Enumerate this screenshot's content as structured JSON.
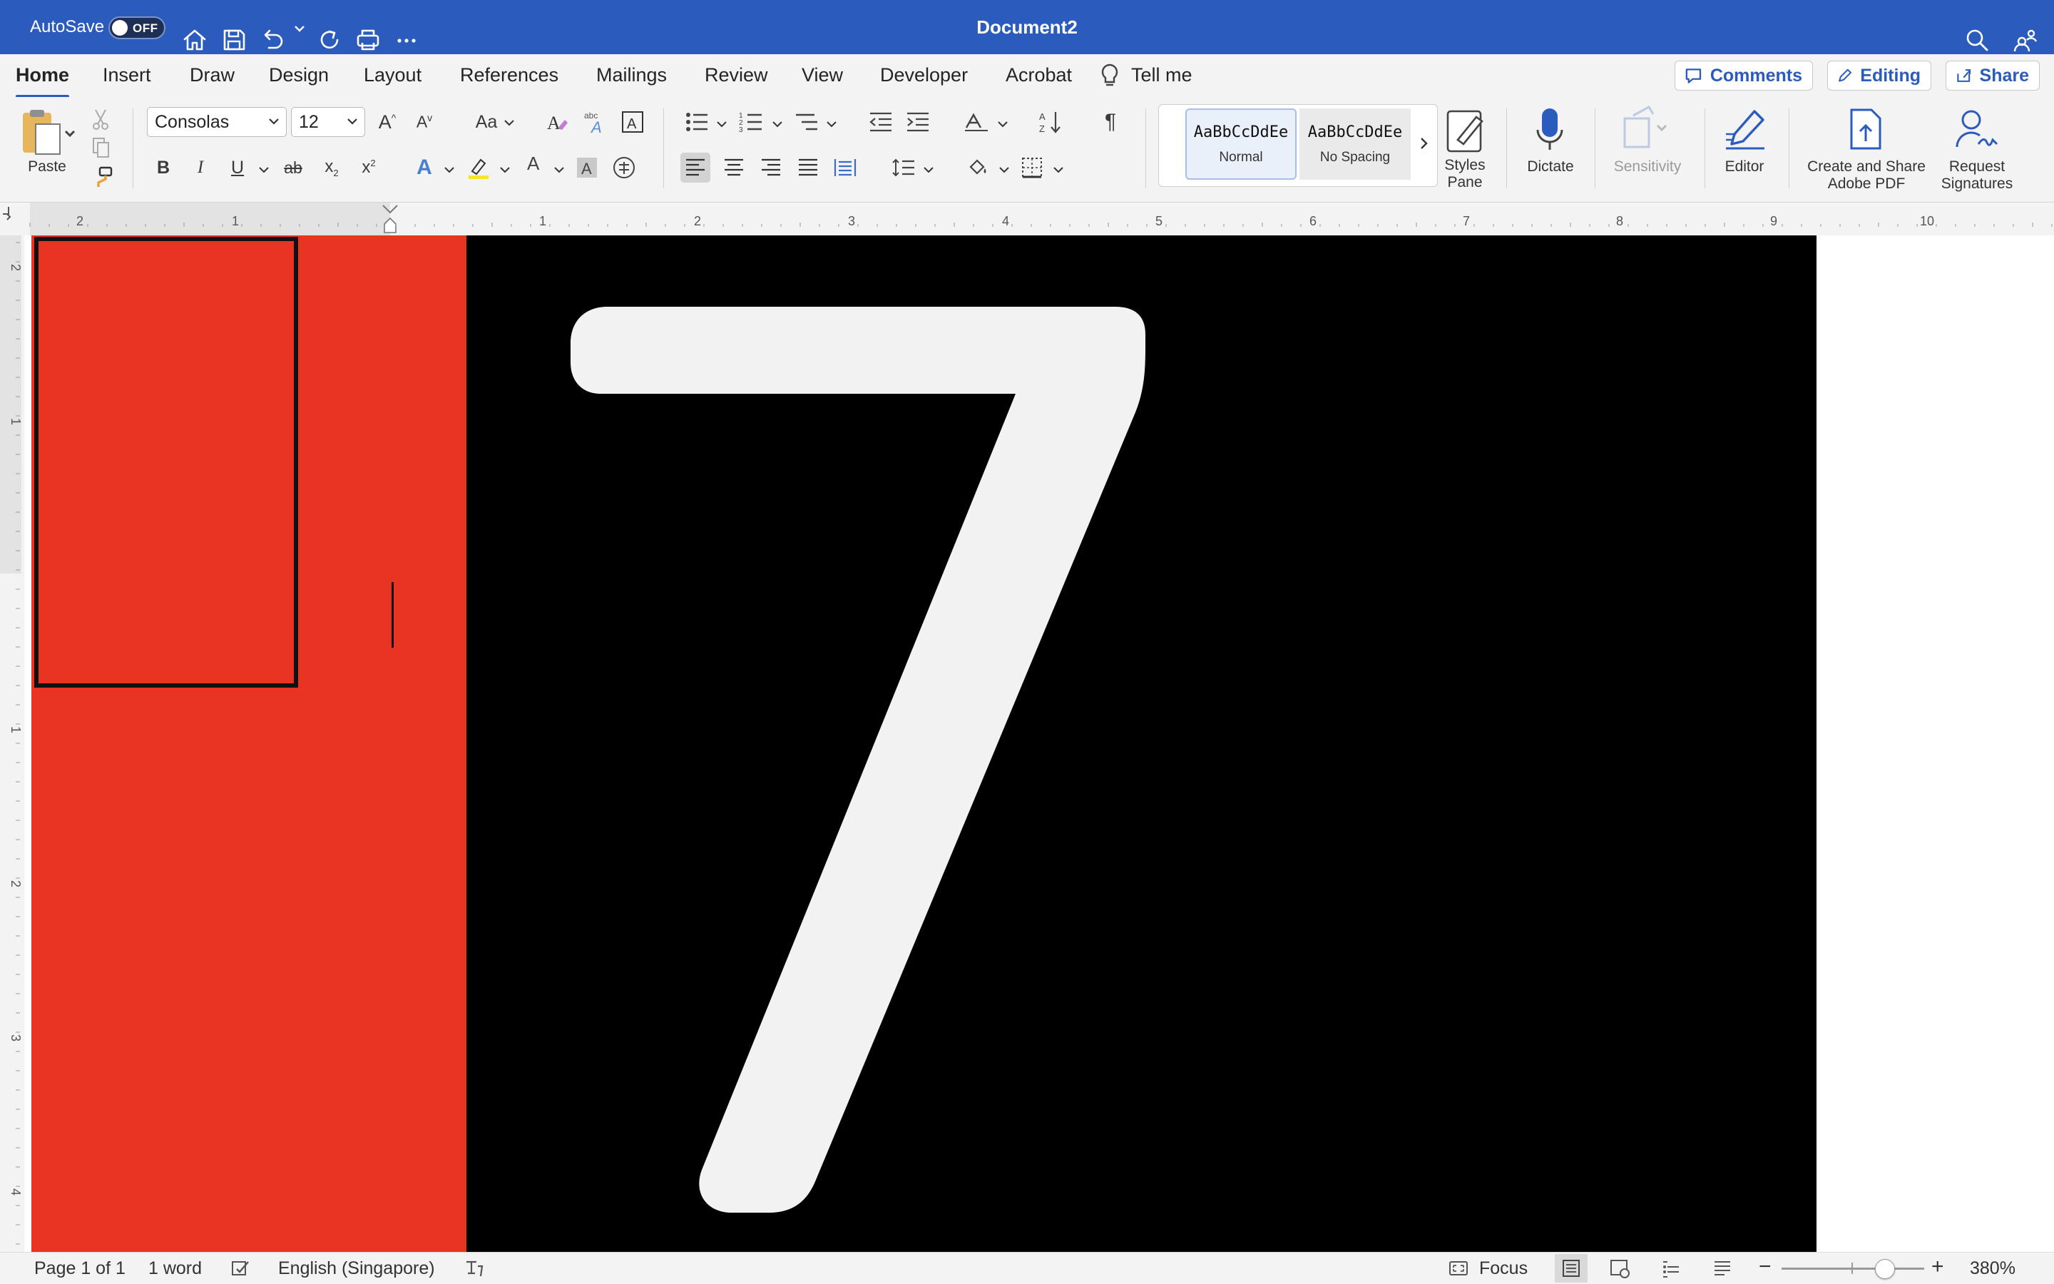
{
  "titlebar": {
    "autosave_label": "AutoSave",
    "autosave_state": "OFF",
    "document_title": "Document2",
    "bg_color": "#2b5cbd"
  },
  "tabs": [
    {
      "label": "Home",
      "active": true
    },
    {
      "label": "Insert"
    },
    {
      "label": "Draw"
    },
    {
      "label": "Design"
    },
    {
      "label": "Layout"
    },
    {
      "label": "References"
    },
    {
      "label": "Mailings"
    },
    {
      "label": "Review"
    },
    {
      "label": "View"
    },
    {
      "label": "Developer"
    },
    {
      "label": "Acrobat"
    },
    {
      "label": "Tell me"
    }
  ],
  "top_buttons": {
    "comments": "Comments",
    "editing": "Editing",
    "share": "Share"
  },
  "ribbon": {
    "paste_label": "Paste",
    "font_name": "Consolas",
    "font_size": "12",
    "format": {
      "bold": "B",
      "italic": "I",
      "underline": "U",
      "strike": "ab",
      "sub": "x",
      "sup": "x",
      "case": "Aa"
    },
    "styles": [
      {
        "preview": "AaBbCcDdEe",
        "name": "Normal",
        "selected": true
      },
      {
        "preview": "AaBbCcDdEe",
        "name": "No Spacing"
      }
    ],
    "styles_pane": [
      "Styles",
      "Pane"
    ],
    "dictate": "Dictate",
    "sensitivity": "Sensitivity",
    "editor": "Editor",
    "create_pdf": [
      "Create and Share",
      "Adobe PDF"
    ],
    "request_signatures": [
      "Request",
      "Signatures"
    ]
  },
  "ruler": {
    "horizontal_labels": [
      "2",
      "1",
      "1",
      "2",
      "3",
      "4",
      "5",
      "6",
      "7",
      "8",
      "9",
      "10"
    ],
    "vertical_labels": [
      "2",
      "1",
      "1",
      "2",
      "3",
      "4"
    ]
  },
  "document": {
    "big_text": "7",
    "colors": {
      "red": "#e93323",
      "black": "#000000",
      "glyph": "#f2f2f2"
    }
  },
  "statusbar": {
    "page": "Page 1 of 1",
    "words": "1 word",
    "language": "English (Singapore)",
    "focus": "Focus",
    "zoom": "380%",
    "zoom_level": 0.72
  },
  "icons": [
    "home-icon",
    "save-icon",
    "undo-icon",
    "redo-icon",
    "print-icon",
    "more-icon",
    "search-icon",
    "share-people-icon",
    "paste-icon",
    "cut-icon",
    "copy-icon",
    "format-painter-icon",
    "dictate-mic-icon",
    "editor-pen-icon",
    "pdf-icon",
    "signature-icon"
  ]
}
